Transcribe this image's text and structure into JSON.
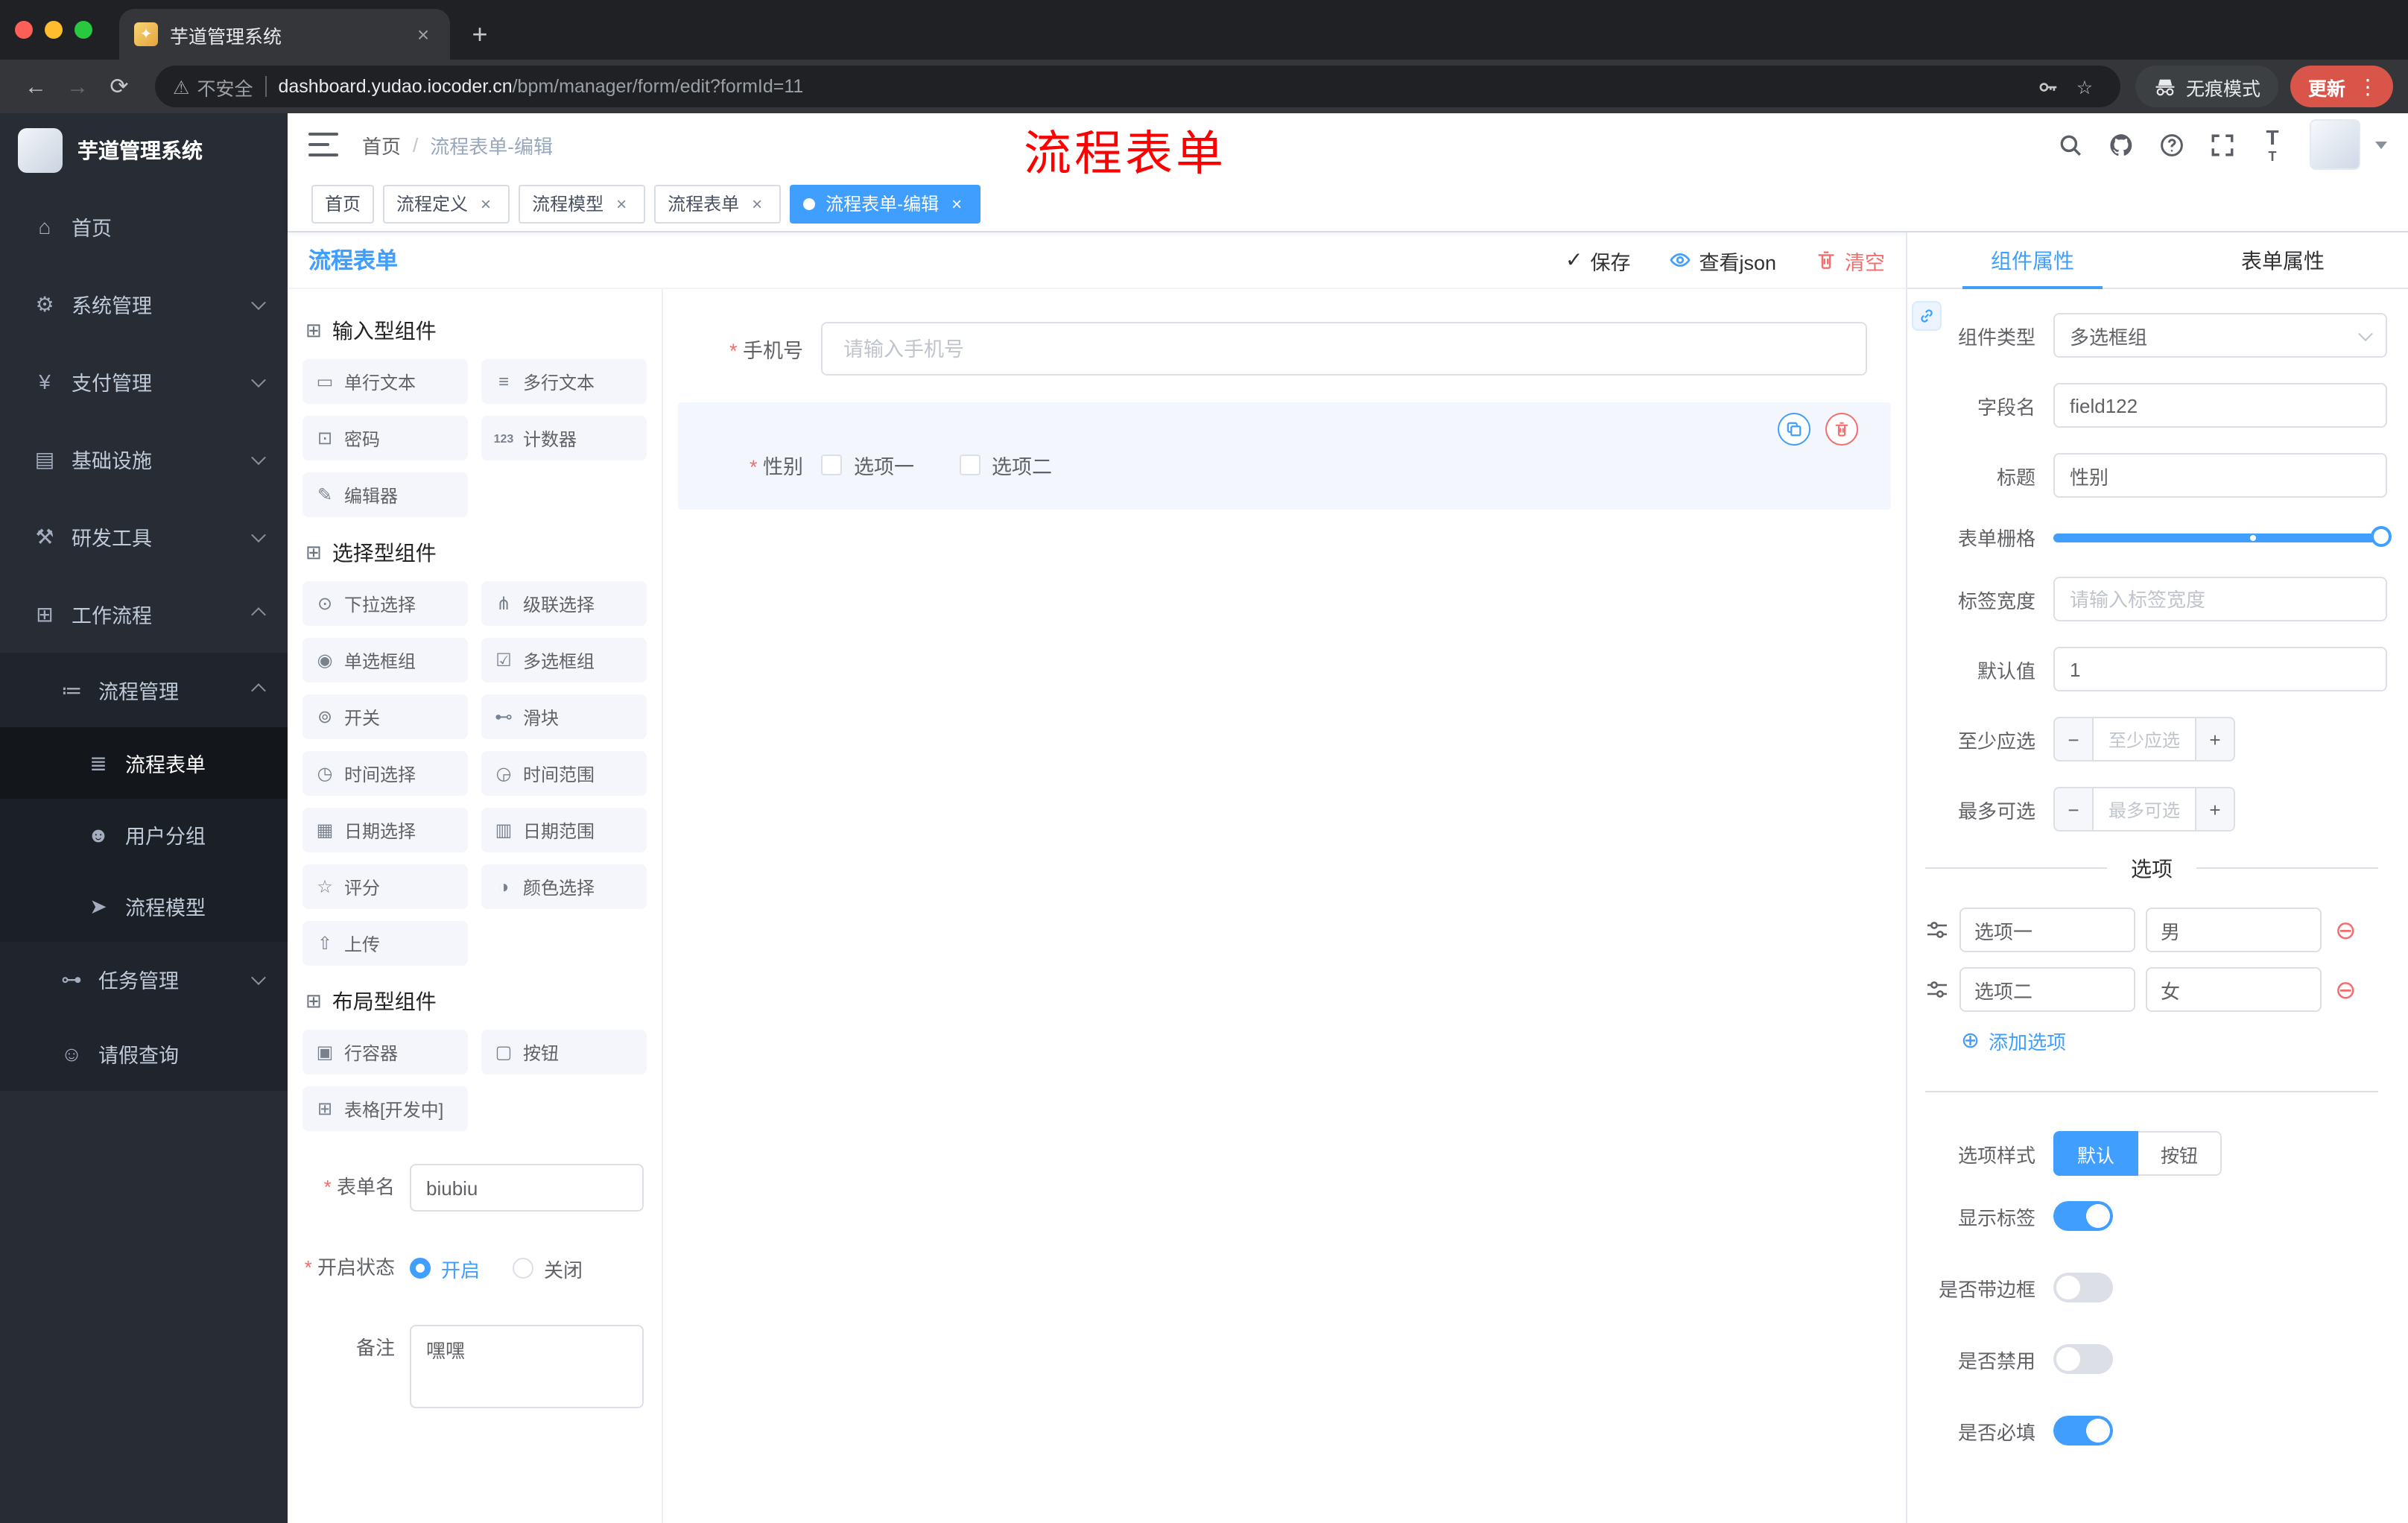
{
  "colors": {
    "primary": "#409eff",
    "danger": "#f56c6c",
    "annotation_red": "#ff0000",
    "update_chip_red": "#d9554a",
    "sidebar_bg": "#272c35",
    "selected_field_bg": "#f4f6fe"
  },
  "browser": {
    "tab_title": "芋道管理系统",
    "omnibox": {
      "security_label": "不安全",
      "domain": "dashboard.yudao.iocoder.cn",
      "path": "/bpm/manager/form/edit?formId=11"
    },
    "incognito_label": "无痕模式",
    "update_label": "更新"
  },
  "sidebar": {
    "app_title": "芋道管理系统",
    "items": [
      {
        "label": "首页"
      },
      {
        "label": "系统管理"
      },
      {
        "label": "支付管理"
      },
      {
        "label": "基础设施"
      },
      {
        "label": "研发工具"
      },
      {
        "label": "工作流程"
      },
      {
        "label": "流程管理"
      },
      {
        "label": "流程表单"
      },
      {
        "label": "用户分组"
      },
      {
        "label": "流程模型"
      },
      {
        "label": "任务管理"
      },
      {
        "label": "请假查询"
      }
    ]
  },
  "navbar": {
    "breadcrumb": {
      "root": "首页",
      "separator": "/",
      "current": "流程表单-编辑"
    },
    "annotation": "流程表单"
  },
  "tags": [
    {
      "label": "首页"
    },
    {
      "label": "流程定义"
    },
    {
      "label": "流程模型"
    },
    {
      "label": "流程表单"
    },
    {
      "label": "流程表单-编辑"
    }
  ],
  "designer": {
    "panel_title": "流程表单",
    "actions": {
      "save": "保存",
      "view_json": "查看json",
      "clear": "清空"
    },
    "groups": [
      {
        "title": "输入型组件",
        "items": [
          "单行文本",
          "多行文本",
          "密码",
          "计数器",
          "编辑器"
        ]
      },
      {
        "title": "选择型组件",
        "items": [
          "下拉选择",
          "级联选择",
          "单选框组",
          "多选框组",
          "开关",
          "滑块",
          "时间选择",
          "时间范围",
          "日期选择",
          "日期范围",
          "评分",
          "颜色选择",
          "上传"
        ]
      },
      {
        "title": "布局型组件",
        "items": [
          "行容器",
          "按钮",
          "表格[开发中]"
        ]
      }
    ],
    "meta": {
      "name": {
        "label": "表单名",
        "value": "biubiu",
        "required": true
      },
      "status": {
        "label": "开启状态",
        "required": true,
        "options": [
          {
            "label": "开启",
            "selected": true
          },
          {
            "label": "关闭",
            "selected": false
          }
        ]
      },
      "remark": {
        "label": "备注",
        "value": "嘿嘿"
      }
    },
    "canvas": {
      "phone": {
        "label": "手机号",
        "placeholder": "请输入手机号",
        "required": true
      },
      "gender": {
        "label": "性别",
        "required": true,
        "options": [
          "选项一",
          "选项二"
        ],
        "selected": true
      }
    }
  },
  "properties": {
    "tabs": [
      {
        "label": "组件属性",
        "active": true
      },
      {
        "label": "表单属性",
        "active": false
      }
    ],
    "component_type": {
      "label": "组件类型",
      "value": "多选框组"
    },
    "field_name": {
      "label": "字段名",
      "value": "field122"
    },
    "title": {
      "label": "标题",
      "value": "性别"
    },
    "form_grid": {
      "label": "表单栅格",
      "value": 24,
      "max": 24
    },
    "label_width": {
      "label": "标签宽度",
      "placeholder": "请输入标签宽度"
    },
    "default_value": {
      "label": "默认值",
      "value": "1"
    },
    "min_select": {
      "label": "至少应选",
      "placeholder": "至少应选"
    },
    "max_select": {
      "label": "最多可选",
      "placeholder": "最多可选"
    },
    "options_title": "选项",
    "options": [
      {
        "label": "选项一",
        "value": "男"
      },
      {
        "label": "选项二",
        "value": "女"
      }
    ],
    "add_option_label": "添加选项",
    "option_style": {
      "label": "选项样式",
      "choices": [
        {
          "label": "默认",
          "active": true
        },
        {
          "label": "按钮",
          "active": false
        }
      ]
    },
    "switches": [
      {
        "label": "显示标签",
        "on": true
      },
      {
        "label": "是否带边框",
        "on": false
      },
      {
        "label": "是否禁用",
        "on": false
      },
      {
        "label": "是否必填",
        "on": true
      }
    ]
  }
}
